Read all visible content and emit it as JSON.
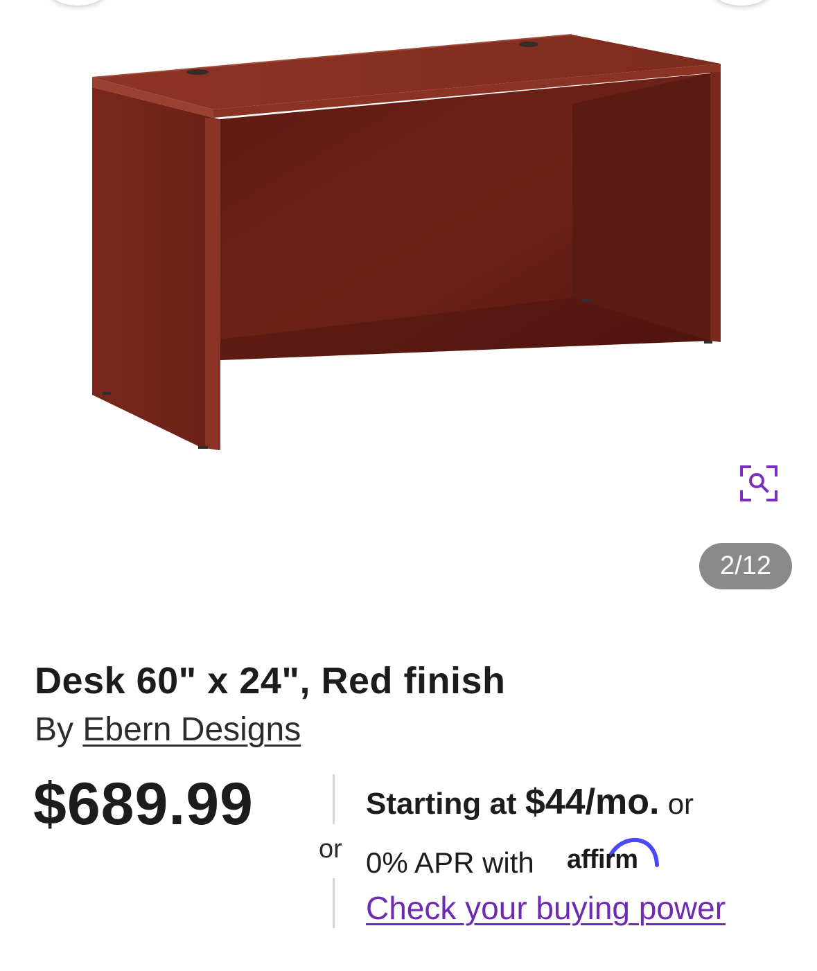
{
  "gallery": {
    "counter": "2/12",
    "image_description_icon": "desk-product-image",
    "zoom_icon": "zoom-search-icon",
    "accent_color": "#7b2fbe"
  },
  "product": {
    "title": "Desk 60\" x 24\", Red finish",
    "by_prefix": "By",
    "brand": "Ebern Designs",
    "price": "$689.99"
  },
  "financing": {
    "or_divider": "or",
    "starting_at": "Starting at",
    "monthly": "$44/mo.",
    "or_suffix": "or",
    "apr_text": "0% APR with",
    "provider": "affirm",
    "cta": "Check your buying power",
    "link_color": "#6f2bb0"
  }
}
